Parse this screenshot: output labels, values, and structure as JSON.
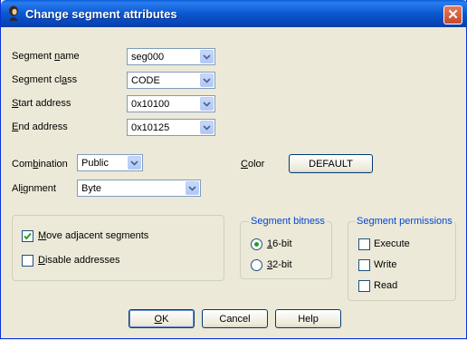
{
  "window": {
    "title": "Change segment attributes",
    "close_glyph": "✕",
    "app_icon": "app-icon"
  },
  "fields": {
    "segment_name": {
      "label_pre": "Segment ",
      "label_key": "n",
      "label_post": "ame",
      "value": "seg000"
    },
    "segment_class": {
      "label_pre": "Segment cl",
      "label_key": "a",
      "label_post": "ss",
      "value": "CODE"
    },
    "start_address": {
      "label_pre": "",
      "label_key": "S",
      "label_post": "tart address",
      "value": "0x10100"
    },
    "end_address": {
      "label_pre": "",
      "label_key": "E",
      "label_post": "nd address",
      "value": "0x10125"
    },
    "combination": {
      "label_pre": "Com",
      "label_key": "b",
      "label_post": "ination",
      "value": "Public"
    },
    "alignment": {
      "label_pre": "Al",
      "label_key": "i",
      "label_post": "gnment",
      "value": "Byte"
    },
    "color": {
      "label_pre": "",
      "label_key": "C",
      "label_post": "olor",
      "button_label": "DEFAULT"
    }
  },
  "options": {
    "move_adjacent": {
      "label_key": "M",
      "label_post": "ove adjacent segments",
      "checked": true
    },
    "disable_addresses": {
      "label_key": "D",
      "label_post": "isable addresses",
      "checked": false
    }
  },
  "bitness": {
    "title": "Segment bitness",
    "bit16": {
      "label_key": "1",
      "label_post": "6-bit",
      "selected": true
    },
    "bit32": {
      "label_key": "3",
      "label_post": "2-bit",
      "selected": false
    }
  },
  "permissions": {
    "title": "Segment permissions",
    "execute": {
      "label": "Execute",
      "checked": false
    },
    "write": {
      "label": "Write",
      "checked": false
    },
    "read": {
      "label": "Read",
      "checked": false
    }
  },
  "buttons": {
    "ok": {
      "label_key": "O",
      "label_post": "K"
    },
    "cancel": "Cancel",
    "help": "Help"
  }
}
